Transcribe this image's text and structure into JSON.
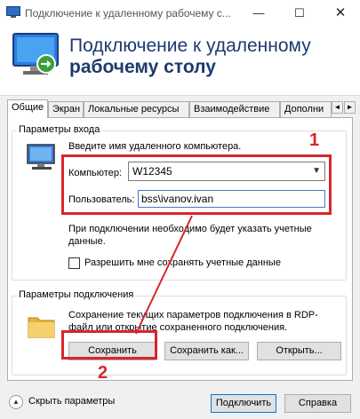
{
  "window": {
    "title": "Подключение к удаленному рабочему с...",
    "min_glyph": "—",
    "max_glyph": "☐",
    "close_glyph": "✕"
  },
  "header": {
    "line1": "Подключение к удаленному",
    "line2": "рабочему столу"
  },
  "tabs": [
    "Общие",
    "Экран",
    "Локальные ресурсы",
    "Взаимодействие",
    "Дополни"
  ],
  "tab_scroll": {
    "left": "◄",
    "right": "►"
  },
  "login": {
    "legend": "Параметры входа",
    "prompt": "Введите имя удаленного компьютера.",
    "computer_label": "Компьютер:",
    "computer_value": "W12345",
    "user_label": "Пользователь:",
    "user_value": "bss\\ivanov.ivan",
    "note": "При подключении необходимо будет указать учетные данные.",
    "remember_label": "Разрешить мне сохранять учетные данные",
    "remember_checked": false
  },
  "connection": {
    "legend": "Параметры подключения",
    "description": "Сохранение текущих параметров подключения в RDP-файл или открытие сохраненного подключения.",
    "save_label": "Сохранить",
    "save_as_label": "Сохранить как...",
    "open_label": "Открыть..."
  },
  "annotations": {
    "marker1": "1",
    "marker2": "2"
  },
  "footer": {
    "show_options_label": "Скрыть параметры",
    "connect_label": "Подключить",
    "help_label": "Справка"
  },
  "colors": {
    "accent_red": "#d9252d",
    "title_blue": "#1e3a6e",
    "focus_blue": "#0078d7"
  }
}
